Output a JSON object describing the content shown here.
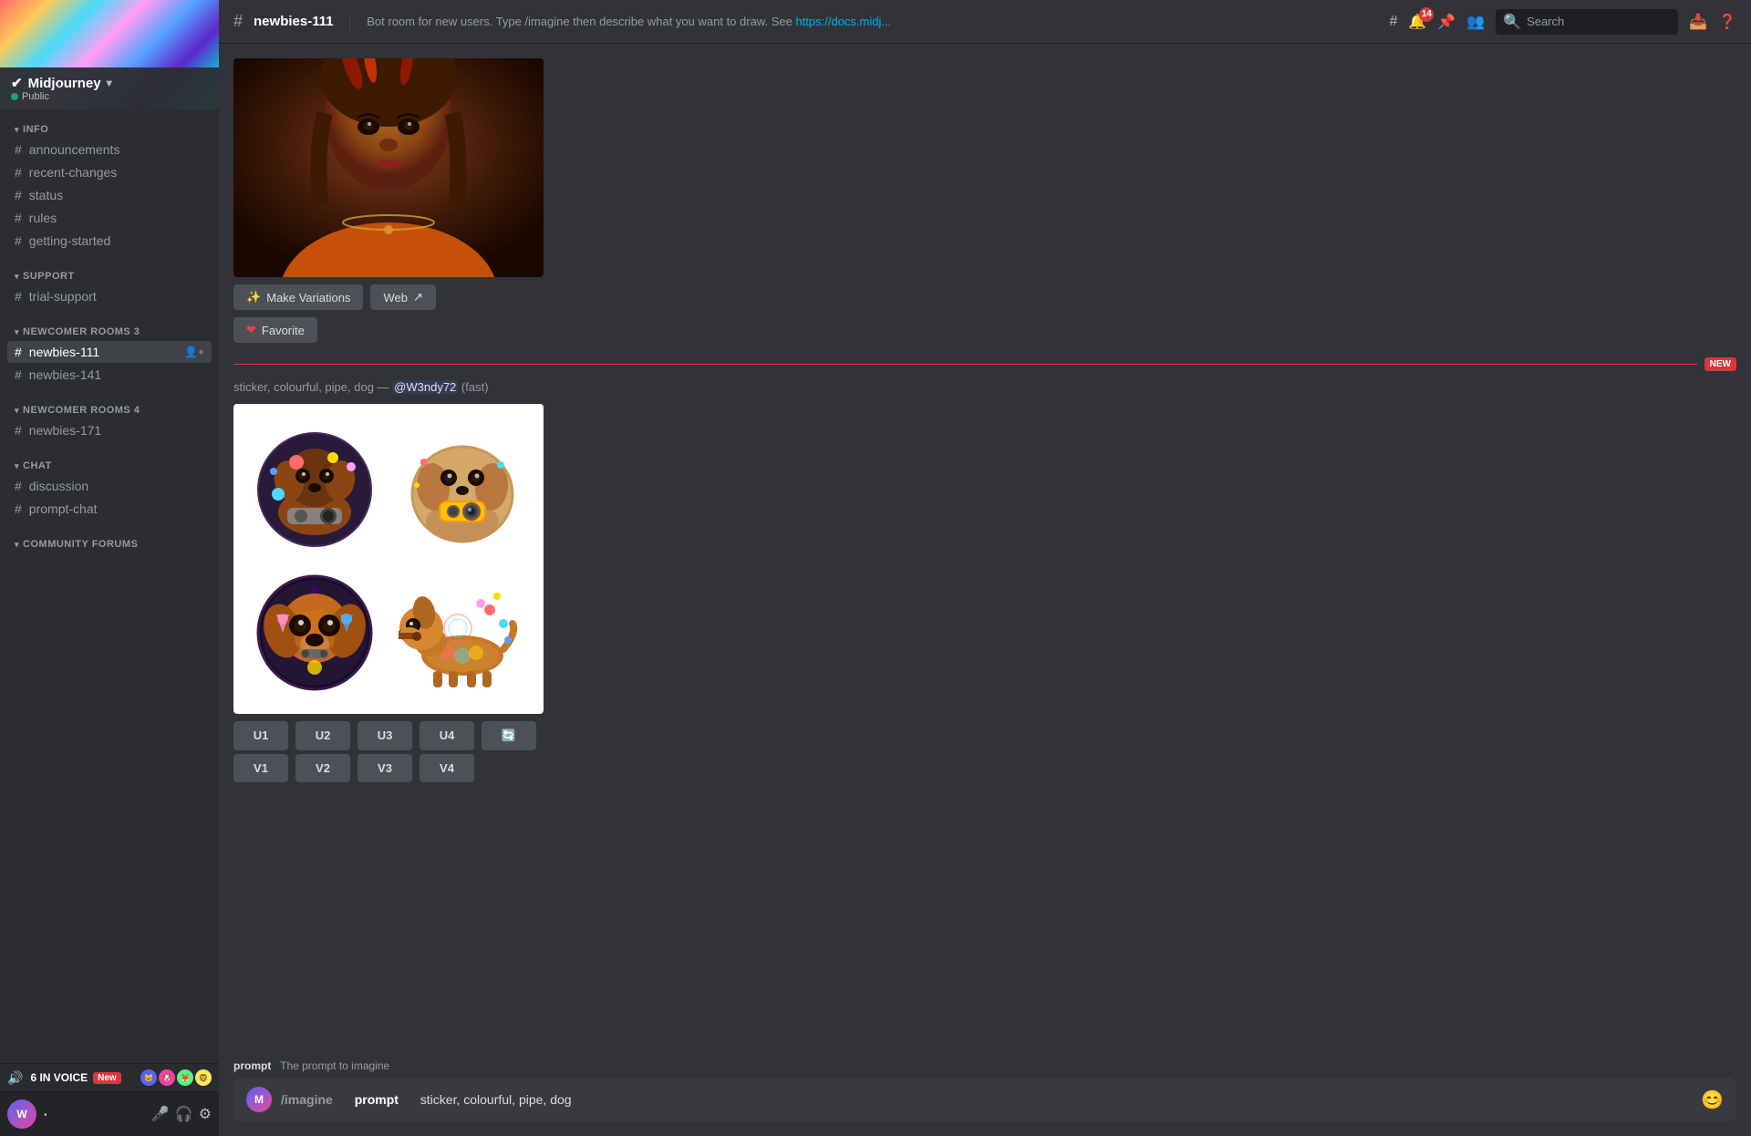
{
  "sidebar": {
    "server_name": "Midjourney",
    "server_verified": true,
    "server_public": "Public",
    "sections": [
      {
        "label": "INFO",
        "items": [
          {
            "id": "announcements",
            "icon": "📢",
            "label": "announcements",
            "type": "hash"
          },
          {
            "id": "recent-changes",
            "icon": "#",
            "label": "recent-changes",
            "type": "hash"
          },
          {
            "id": "status",
            "icon": "#",
            "label": "status",
            "type": "hash"
          },
          {
            "id": "rules",
            "icon": "#",
            "label": "rules",
            "type": "hash"
          },
          {
            "id": "getting-started",
            "icon": "#",
            "label": "getting-started",
            "type": "hash"
          }
        ]
      },
      {
        "label": "SUPPORT",
        "items": [
          {
            "id": "trial-support",
            "icon": "#",
            "label": "trial-support",
            "type": "hash"
          }
        ]
      },
      {
        "label": "NEWCOMER ROOMS 3",
        "items": [
          {
            "id": "newbies-111",
            "icon": "#",
            "label": "newbies-111",
            "type": "hash",
            "active": true
          },
          {
            "id": "newbies-141",
            "icon": "#",
            "label": "newbies-141",
            "type": "hash"
          }
        ]
      },
      {
        "label": "NEWCOMER ROOMS 4",
        "items": [
          {
            "id": "newbies-171",
            "icon": "#",
            "label": "newbies-171",
            "type": "hash"
          }
        ]
      },
      {
        "label": "CHAT",
        "items": [
          {
            "id": "discussion",
            "icon": "#",
            "label": "discussion",
            "type": "hash"
          },
          {
            "id": "prompt-chat",
            "icon": "#",
            "label": "prompt-chat",
            "type": "hash"
          }
        ]
      },
      {
        "label": "COMMUNITY FORUMS",
        "items": []
      }
    ],
    "voice_section": {
      "count": "6 IN VOICE",
      "badge": "New"
    }
  },
  "channel_header": {
    "channel_name": "newbies-111",
    "topic": "Bot room for new users. Type /imagine then describe what you want to draw. See",
    "topic_link": "https://docs.midj...",
    "member_count": "14"
  },
  "search": {
    "placeholder": "Search"
  },
  "messages": {
    "portrait": {
      "buttons": {
        "make_variations": "Make Variations",
        "web": "Web",
        "favorite": "Favorite"
      }
    },
    "sticker": {
      "prompt_text": "sticker, colourful, pipe, dog",
      "separator": "—",
      "mention": "@W3ndy72",
      "speed": "(fast)",
      "upscale_buttons": [
        "U1",
        "U2",
        "U3",
        "U4"
      ],
      "variation_buttons": [
        "V1",
        "V2",
        "V3",
        "V4"
      ]
    }
  },
  "input": {
    "slash_command": "/imagine",
    "prompt_label": "prompt",
    "placeholder_text": "The prompt to imagine",
    "current_value": "sticker, colourful, pipe, dog",
    "prompt_hint_label": "prompt",
    "prompt_hint_desc": "The prompt to imagine"
  }
}
